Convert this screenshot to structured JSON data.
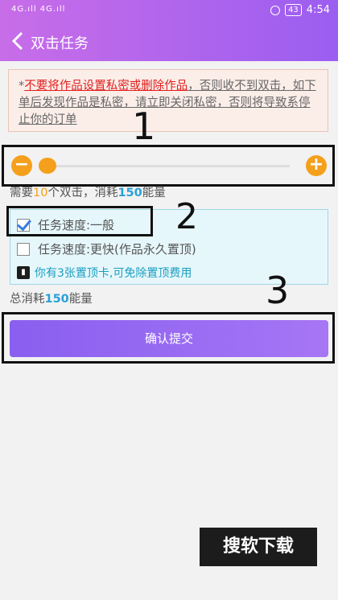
{
  "status": {
    "signal": "4G.ıll 4G.ıll",
    "battery": "43",
    "time": "4:54"
  },
  "header": {
    "title": "双击任务"
  },
  "warning": {
    "prefix": "*",
    "red": "不要将作品设置私密或删除作品",
    "rest1": "，否则收不到双击，如下单后发现作品是私密，请立即关闭私密，否则将导致系",
    "rest2": "停止你的订单"
  },
  "slider": {
    "minus": "−",
    "plus": "+",
    "value_fraction": 0.0
  },
  "need": {
    "pre": "需要",
    "count": "10",
    "mid": "个双击，消耗",
    "energy": "150",
    "post": "能量"
  },
  "options": [
    {
      "label": "任务速度:一般",
      "checked": true
    },
    {
      "label": "任务速度:更快(作品永久置顶)",
      "checked": false
    }
  ],
  "card_text": "你有3张置顶卡,可免除置顶费用",
  "total": {
    "pre": "总消耗",
    "energy": "150",
    "post": "能量"
  },
  "submit_label": "确认提交",
  "annotations": {
    "a1": "1",
    "a2": "2",
    "a3": "3"
  },
  "watermark": "搜软下载"
}
